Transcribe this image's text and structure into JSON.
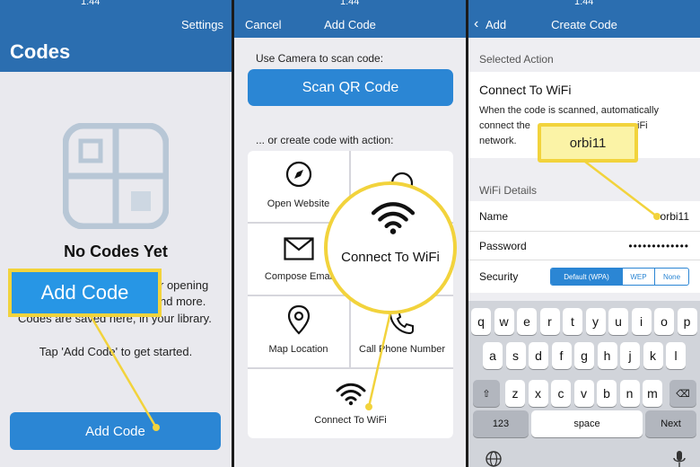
{
  "colors": {
    "brand_blue": "#2b6eb0",
    "button_blue": "#2b86d4",
    "highlight_yellow": "#f2d33c"
  },
  "panel1": {
    "status_time": "1:44",
    "settings_label": "Settings",
    "title": "Codes",
    "empty_icon": "qr-code-placeholder-icon",
    "empty_title": "No Codes Yet",
    "desc_line1": "r opening",
    "desc_line2": "nd more.",
    "desc_line3": "Codes are saved here, in your library.",
    "hint": "Tap 'Add Code' to get started.",
    "callout": "Add Code",
    "add_button": "Add Code"
  },
  "panel2": {
    "status_time": "1:44",
    "cancel": "Cancel",
    "title": "Add Code",
    "camera_label": "Use Camera to scan code:",
    "scan_button": "Scan QR Code",
    "or_label": "... or create code with action:",
    "actions": [
      {
        "label": "Open Website",
        "icon": "compass-icon"
      },
      {
        "label": "",
        "icon": "search-icon"
      },
      {
        "label": "Compose Emai",
        "icon": "envelope-icon"
      },
      {
        "label": "",
        "icon": "blank"
      },
      {
        "label": "Map Location",
        "icon": "map-pin-icon"
      },
      {
        "label": "Call Phone Number",
        "icon": "phone-icon"
      },
      {
        "label": "Connect To WiFi",
        "icon": "wifi-icon"
      }
    ],
    "magnifier_label": "Connect To WiFi"
  },
  "panel3": {
    "status_time": "1:44",
    "back": "Add",
    "title": "Create Code",
    "selected_action_header": "Selected Action",
    "action_title": "Connect To WiFi",
    "action_desc_line1": "When the code is scanned, automatically",
    "action_desc_line2a": "connect the",
    "action_desc_line2b": "iFi",
    "action_desc_line3": "network.",
    "callout": "orbi11",
    "wifi_header": "WiFi Details",
    "name_label": "Name",
    "name_value": "orbi11",
    "password_label": "Password",
    "password_value": "•••••••••••••",
    "security_label": "Security",
    "security_options": [
      "Default (WPA)",
      "WEP",
      "None"
    ],
    "keyboard": {
      "row1": [
        "q",
        "w",
        "e",
        "r",
        "t",
        "y",
        "u",
        "i",
        "o",
        "p"
      ],
      "row2": [
        "a",
        "s",
        "d",
        "f",
        "g",
        "h",
        "j",
        "k",
        "l"
      ],
      "row3": [
        "z",
        "x",
        "c",
        "v",
        "b",
        "n",
        "m"
      ],
      "num_key": "123",
      "space_key": "space",
      "next_key": "Next"
    }
  }
}
